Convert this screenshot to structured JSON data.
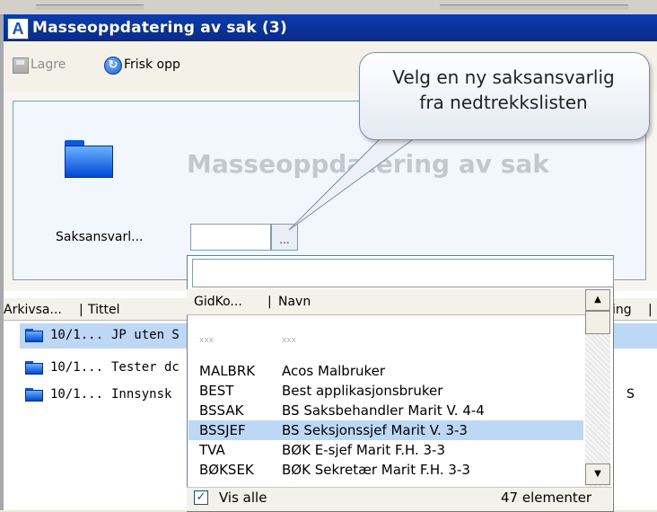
{
  "window": {
    "title": "Masseoppdatering av sak (3)",
    "icon_letter": "A"
  },
  "toolbar": {
    "save_label": "Lagre",
    "refresh_label": "Frisk opp"
  },
  "callout": {
    "line1": "Velg en ny saksansvarlig",
    "line2": "fra nedtrekkslisten"
  },
  "form": {
    "heading": "Masseoppdatering av sak",
    "field_label": "Saksansvarl...",
    "browse_label": "..."
  },
  "grid": {
    "columns": [
      "Arkivsa...",
      "Tittel",
      "ing"
    ],
    "rows": [
      {
        "id": "10/1...",
        "title": "JP uten S",
        "extra": "",
        "selected": true
      },
      {
        "id": "10/1...",
        "title": "Tester dc",
        "extra": "",
        "selected": false
      },
      {
        "id": "10/1...",
        "title": "Innsynsk",
        "extra": "S",
        "selected": false
      }
    ]
  },
  "dropdown": {
    "search_value": "",
    "columns": [
      "GidKo...",
      "Navn"
    ],
    "items": [
      {
        "code": "xxx",
        "name": "xxx",
        "faded": true
      },
      {
        "code": "MALBRK",
        "name": "Acos Malbruker"
      },
      {
        "code": "BEST",
        "name": "Best applikasjonsbruker"
      },
      {
        "code": "BSSAK",
        "name": "BS Saksbehandler Marit V.  4-4"
      },
      {
        "code": "BSSJEF",
        "name": "BS Seksjonssjef  Marit V.  3-3",
        "selected": true
      },
      {
        "code": "TVA",
        "name": "BØK E-sjef Marit F.H. 3-3"
      },
      {
        "code": "BØKSEK",
        "name": "BØK Sekretær  Marit F.H. 3-3"
      }
    ],
    "show_all_label": "Vis alle",
    "show_all_checked": "✓",
    "count_label": "47 elementer"
  }
}
